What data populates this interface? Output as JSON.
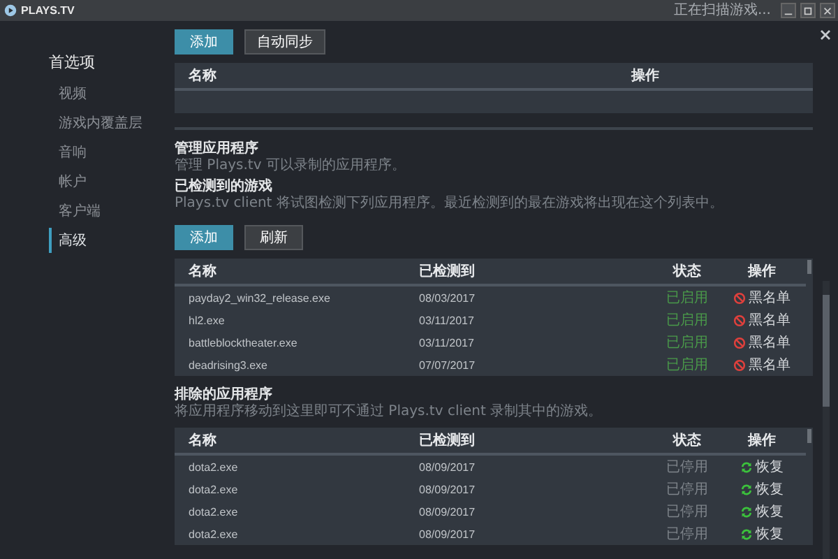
{
  "window": {
    "logo": "PLAYS.TV",
    "status": "正在扫描游戏..."
  },
  "sidebar": {
    "title": "首选项",
    "items": [
      {
        "label": "视频",
        "selected": false
      },
      {
        "label": "游戏内覆盖层",
        "selected": false
      },
      {
        "label": "音响",
        "selected": false
      },
      {
        "label": "帐户",
        "selected": false
      },
      {
        "label": "客户端",
        "selected": false
      },
      {
        "label": "高级",
        "selected": true
      }
    ]
  },
  "top_buttons": [
    {
      "label": "添加",
      "kind": "primary"
    },
    {
      "label": "自动同步",
      "kind": "secondary"
    }
  ],
  "top_table": {
    "columns": [
      "名称",
      "操作"
    ]
  },
  "manage": {
    "title": "管理应用程序",
    "description": "管理 Plays.tv 可以录制的应用程序。"
  },
  "detected": {
    "title": "已检测到的游戏",
    "description": "Plays.tv client 将试图检测下列应用程序。最近检测到的最在游戏将出现在这个列表中。",
    "buttons": [
      {
        "label": "添加",
        "kind": "primary"
      },
      {
        "label": "刷新",
        "kind": "secondary"
      }
    ],
    "columns": [
      "名称",
      "已检测到",
      "状态",
      "操作"
    ],
    "rows": [
      {
        "name": "payday2_win32_release.exe",
        "date": "08/03/2017",
        "status": "已启用",
        "kind": "enabled",
        "action": "黑名单"
      },
      {
        "name": "hl2.exe",
        "date": "03/11/2017",
        "status": "已启用",
        "kind": "enabled",
        "action": "黑名单"
      },
      {
        "name": "battleblocktheater.exe",
        "date": "03/11/2017",
        "status": "已启用",
        "kind": "enabled",
        "action": "黑名单"
      },
      {
        "name": "deadrising3.exe",
        "date": "07/07/2017",
        "status": "已启用",
        "kind": "enabled",
        "action": "黑名单"
      }
    ]
  },
  "excluded": {
    "title": "排除的应用程序",
    "description": "将应用程序移动到这里即可不通过 Plays.tv client 录制其中的游戏。",
    "columns": [
      "名称",
      "已检测到",
      "状态",
      "操作"
    ],
    "rows": [
      {
        "name": "dota2.exe",
        "date": "08/09/2017",
        "status": "已停用",
        "kind": "disabled",
        "action": "恢复"
      },
      {
        "name": "dota2.exe",
        "date": "08/09/2017",
        "status": "已停用",
        "kind": "disabled",
        "action": "恢复"
      },
      {
        "name": "dota2.exe",
        "date": "08/09/2017",
        "status": "已停用",
        "kind": "disabled",
        "action": "恢复"
      },
      {
        "name": "dota2.exe",
        "date": "08/09/2017",
        "status": "已停用",
        "kind": "disabled",
        "action": "恢复"
      }
    ]
  }
}
